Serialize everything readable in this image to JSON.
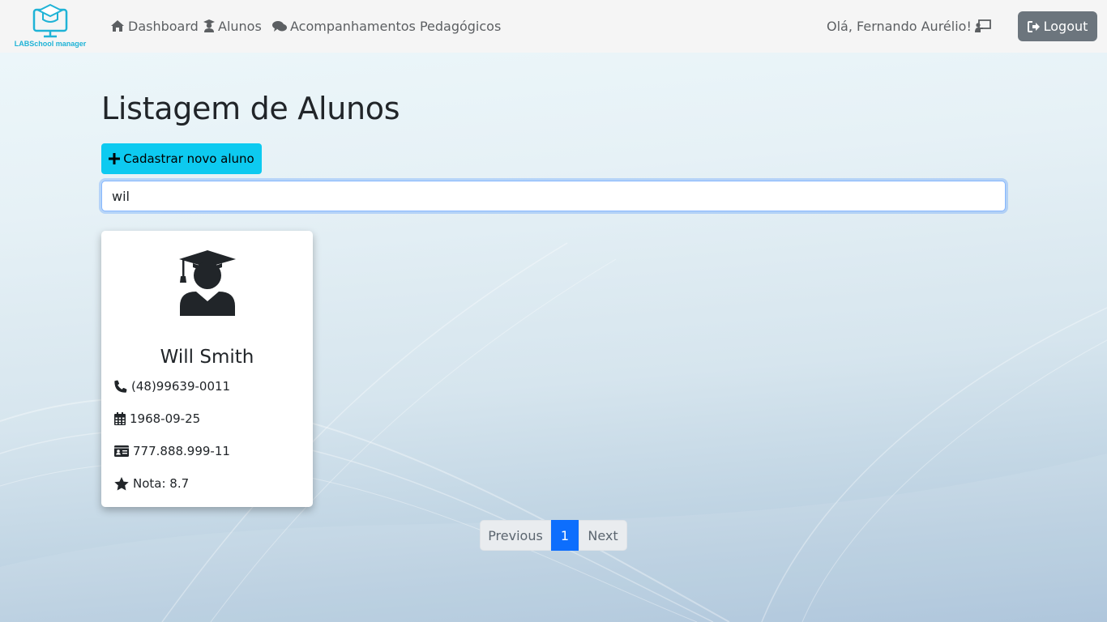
{
  "brand": {
    "name": "LABSchool manager"
  },
  "nav": {
    "items": [
      {
        "label": "Dashboard",
        "icon": "home-icon"
      },
      {
        "label": "Alunos",
        "icon": "user-graduate-icon"
      },
      {
        "label": "Acompanhamentos Pedagógicos",
        "icon": "comments-icon"
      }
    ],
    "greeting": "Olá, Fernando Aurélio!",
    "logout_label": "Logout"
  },
  "main": {
    "title": "Listagem de Alunos",
    "add_button_label": "Cadastrar novo aluno",
    "search": {
      "value": "wil",
      "placeholder": ""
    },
    "students": [
      {
        "name": "Will Smith",
        "phone": "(48)99639-0011",
        "birthdate": "1968-09-25",
        "cpf": "777.888.999-11",
        "grade": "Nota: 8.7"
      }
    ]
  },
  "pagination": {
    "previous": "Previous",
    "current_page": "1",
    "next": "Next"
  },
  "colors": {
    "navbar_bg": "#f5f5f5",
    "brand_accent": "#1fb3d6",
    "logout_bg": "#6c757d",
    "add_button_bg": "#0dcaf0",
    "active_page": "#0d6efd"
  }
}
